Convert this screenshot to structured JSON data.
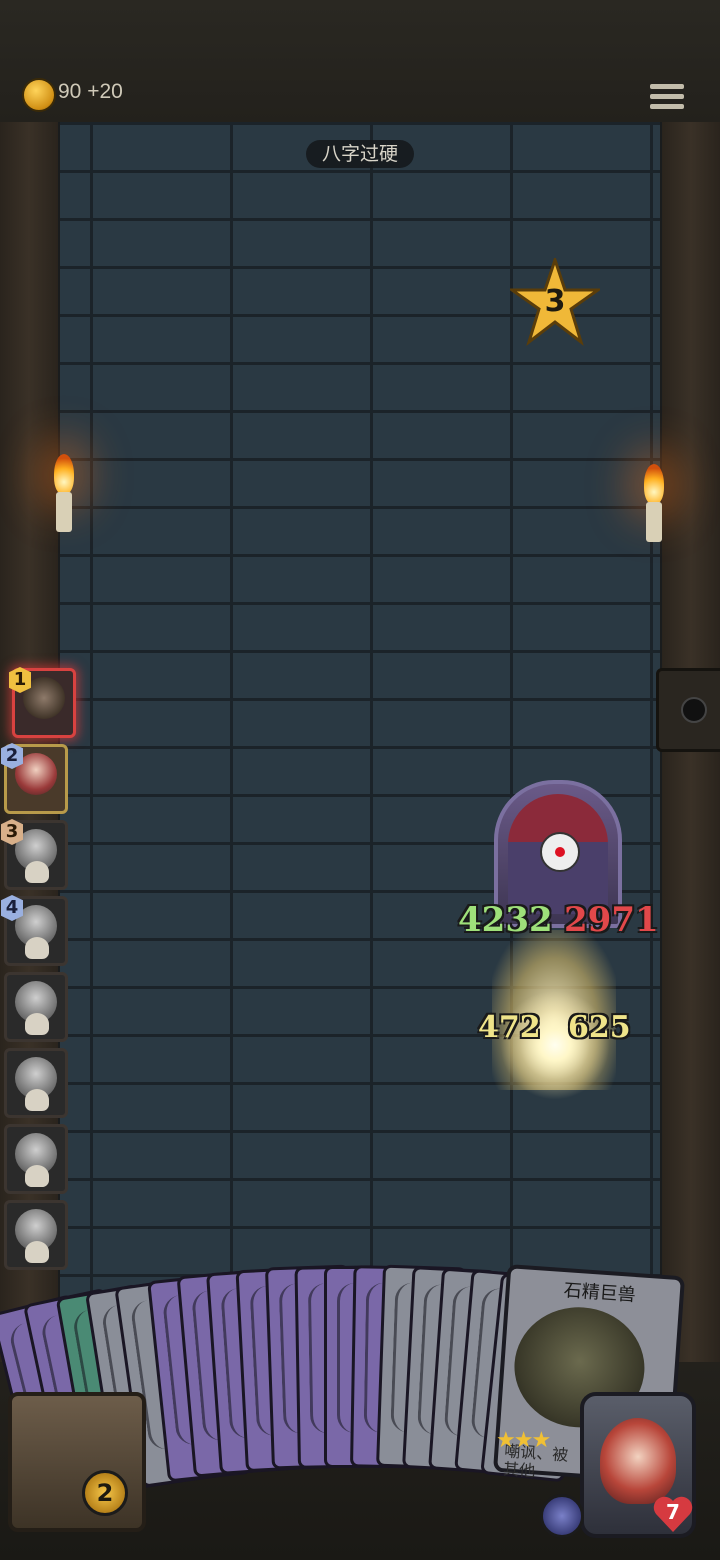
{
  "hud": {
    "coins": "90",
    "coin_bonus": "+20",
    "level_name": "八字过硬",
    "star_value": "3"
  },
  "battle": {
    "enemy_attack": "4232",
    "enemy_health": "2971",
    "ally_attack": "472",
    "ally_health": "625"
  },
  "queue": [
    {
      "num": "1"
    },
    {
      "num": "2"
    },
    {
      "num": "3"
    },
    {
      "num": "4"
    }
  ],
  "featured_card": {
    "title": "石精巨兽",
    "text_line1": "嘲讽、被",
    "text_line2": "其他"
  },
  "player": {
    "chest_count": "2",
    "health": "7"
  },
  "colors": {
    "attack": "#9ee07a",
    "health": "#e2484a",
    "highlight": "#efe48a",
    "gold": "#f0c040"
  }
}
